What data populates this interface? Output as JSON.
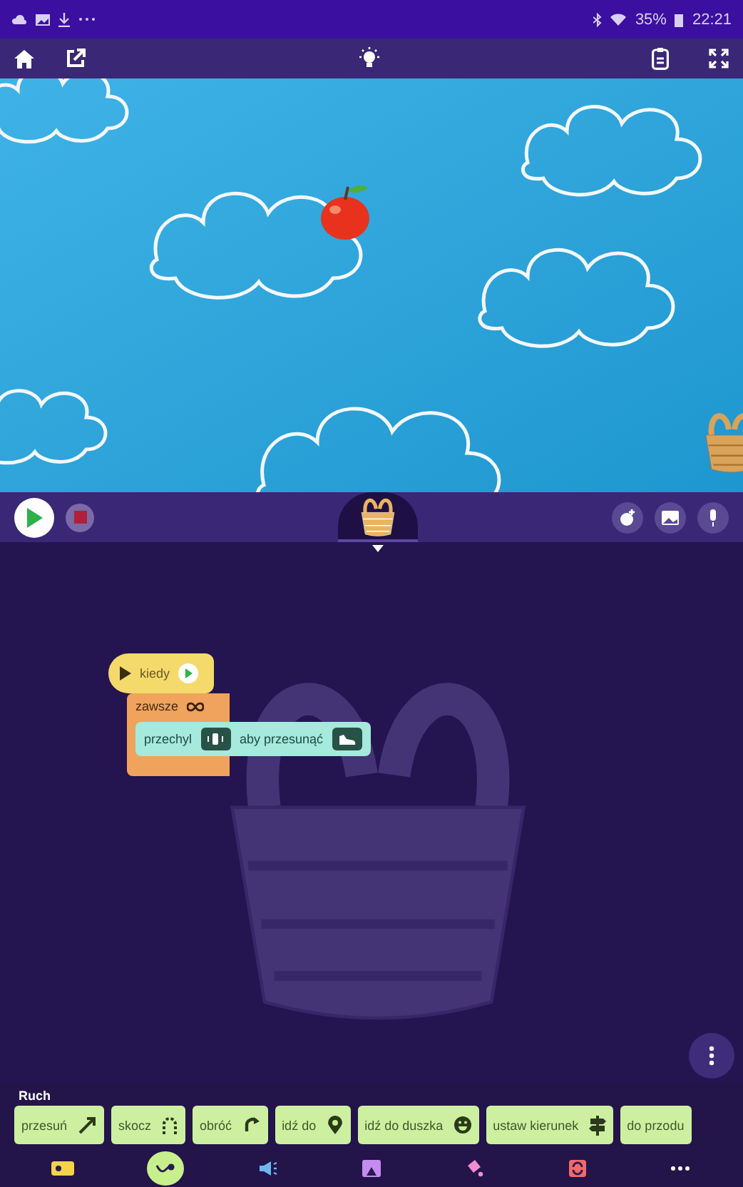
{
  "status_bar": {
    "battery": "35%",
    "time": "22:21"
  },
  "stage": {
    "sprite_selected": true
  },
  "script": {
    "trigger": "kiedy",
    "loop": "zawsze",
    "action": {
      "before": "przechyl",
      "after": "aby przesunąć"
    }
  },
  "palette": {
    "category_title": "Ruch",
    "blocks": [
      {
        "label": "przesuń",
        "kind": "diagonal"
      },
      {
        "label": "skocz",
        "kind": "jump"
      },
      {
        "label": "obróć",
        "kind": "turn"
      },
      {
        "label": "idź do",
        "kind": "pin"
      },
      {
        "label": "idź do duszka",
        "kind": "face"
      },
      {
        "label": "ustaw kierunek",
        "kind": "sign"
      },
      {
        "label": "do przodu",
        "kind": "none"
      }
    ]
  },
  "categories": [
    {
      "kind": "event",
      "selected": false,
      "color": "#f3d34a"
    },
    {
      "kind": "motion",
      "selected": true,
      "color": "#c7f08c"
    },
    {
      "kind": "sound",
      "selected": false,
      "color": "#6fb6f0"
    },
    {
      "kind": "looks",
      "selected": false,
      "color": "#c58cf0"
    },
    {
      "kind": "pen",
      "selected": false,
      "color": "#f08cd0"
    },
    {
      "kind": "control",
      "selected": false,
      "color": "#f06a6a"
    },
    {
      "kind": "more",
      "selected": false,
      "color": "#ffffff"
    }
  ]
}
